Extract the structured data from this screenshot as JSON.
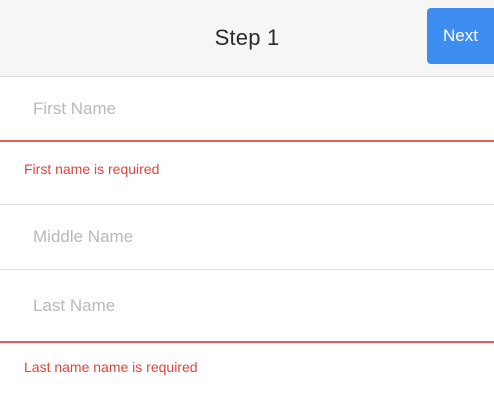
{
  "header": {
    "title": "Step 1",
    "next_label": "Next"
  },
  "form": {
    "first_name": {
      "value": "",
      "placeholder": "First Name",
      "error": "First name is required"
    },
    "middle_name": {
      "value": "",
      "placeholder": "Middle Name"
    },
    "last_name": {
      "value": "",
      "placeholder": "Last Name",
      "error": "Last name name is required"
    }
  },
  "colors": {
    "accent": "#3d8ef0",
    "error": "#e0443f",
    "header_bg": "#f6f6f6"
  }
}
